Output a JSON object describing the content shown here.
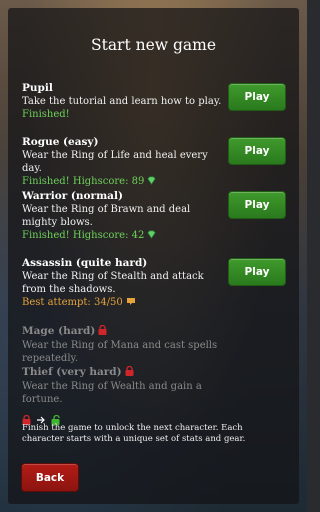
{
  "title": "Start new game",
  "characters": [
    {
      "name": "Pupil",
      "desc": "Take the tutorial and learn how to play.",
      "status": "Finished!",
      "play": "Play"
    },
    {
      "name": "Rogue (easy)",
      "desc": "Wear the Ring of Life and heal every day.",
      "status": "Finished! Highscore: 89",
      "play": "Play"
    },
    {
      "name": "Warrior (normal)",
      "desc": "Wear the Ring of Brawn and deal mighty blows.",
      "status": "Finished! Highscore: 42",
      "play": "Play"
    },
    {
      "name": "Assassin (quite hard)",
      "desc": "Wear the Ring of Stealth and attack from the shadows.",
      "status": "Best attempt: 34/50",
      "play": "Play"
    },
    {
      "name": "Mage (hard)",
      "desc": "Wear the Ring of Mana and cast spells repeatedly."
    },
    {
      "name": "Thief (very hard)",
      "desc": "Wear the Ring of Wealth and gain a fortune."
    }
  ],
  "note": "Finish the game to unlock the next character. Each character starts with a unique set of stats and gear.",
  "back": "Back",
  "colors": {
    "finished": "#6ed15a",
    "best": "#e7a33b",
    "play_button": "#3f9a2c",
    "back_button": "#b41c16",
    "lock": "#d0252a",
    "unlock": "#3fb531",
    "gem": "#5fd06a"
  },
  "icons": {
    "gem": "green-gem-icon",
    "lock": "red-lock-icon",
    "unlock": "green-unlock-icon",
    "attempt": "orange-card-icon"
  }
}
